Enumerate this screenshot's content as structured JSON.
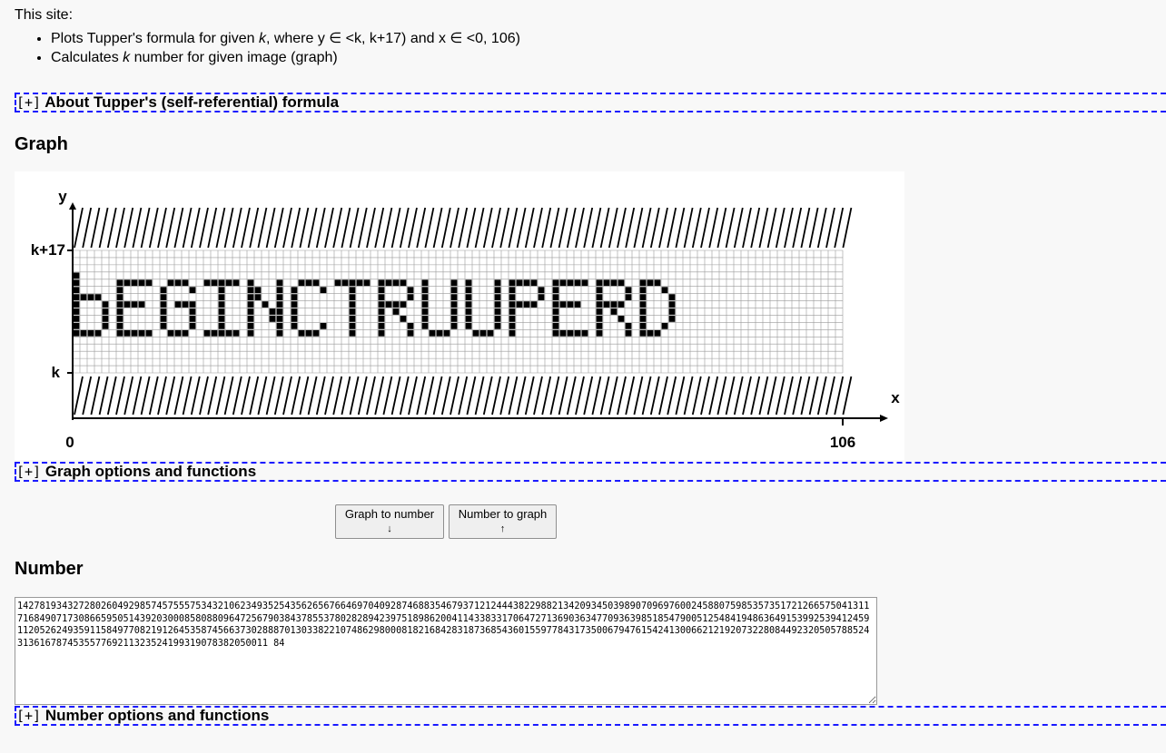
{
  "intro": {
    "lead": "This site:",
    "bullets": [
      "Plots Tupper's formula for given k, where y ∈ <k, k+17) and x ∈ <0, 106)",
      "Calculates k number for given image (graph)"
    ]
  },
  "sections": {
    "toggle": "[+]",
    "about": "About Tupper's (self-referential) formula",
    "graph_options": "Graph options and functions",
    "number_options": "Number options and functions"
  },
  "graph": {
    "heading": "Graph",
    "y_label": "y",
    "x_label": "x",
    "k_top_label": "k+17",
    "k_label": "k",
    "x_start": "0",
    "x_end": "106",
    "grid_cols": 106,
    "grid_rows": 17,
    "bitmap_text": "bEGINCTRUUPERD",
    "colors": {
      "filled": "#000000",
      "grid": "#9a9a9a",
      "background": "#ffffff"
    }
  },
  "buttons": {
    "graph_to_number": "Graph to number",
    "graph_to_number_arrow": "↓",
    "number_to_graph": "Number to graph",
    "number_to_graph_arrow": "↑"
  },
  "number": {
    "heading": "Number",
    "value": "142781934327280260492985745755575343210623493525435626567664697040928746883546793712124443822988213420934503989070969760024588075985357351721266575041311716849071730866595051439203000858088096472567903843785537802828942397518986200411433833170647271369036347709363985185479005125484194863649153992539412459112052624935911584977082191264535874566373028887013033822107486298000818216842831873685436015597784317350067947615424130066212192073228084492320505788524313616787453557769211323524199319078382050011 84"
  }
}
